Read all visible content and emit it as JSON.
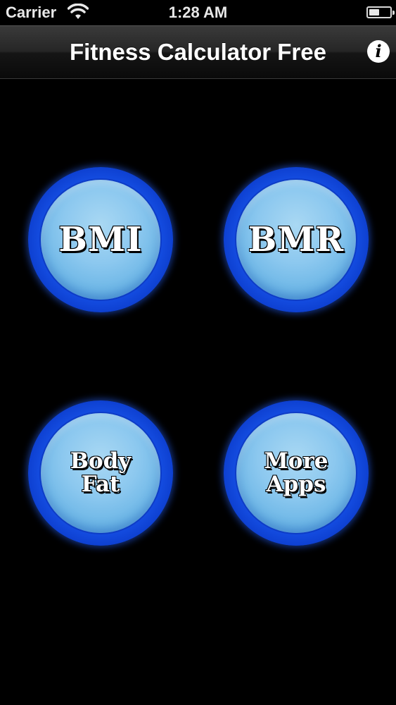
{
  "status_bar": {
    "carrier": "Carrier",
    "time": "1:28 AM",
    "wifi_icon": "wifi-icon",
    "battery_icon": "battery-icon"
  },
  "nav_bar": {
    "title": "Fitness Calculator Free",
    "info_icon": "info-icon",
    "info_glyph": "i"
  },
  "buttons": [
    {
      "label": "BMI"
    },
    {
      "label": "BMR"
    },
    {
      "label": "Body\nFat"
    },
    {
      "label": "More\nApps"
    }
  ],
  "colors": {
    "background": "#000000",
    "button_ring": "#1650e6",
    "button_face": "#8cc8ef",
    "label_text": "#ffffff"
  }
}
